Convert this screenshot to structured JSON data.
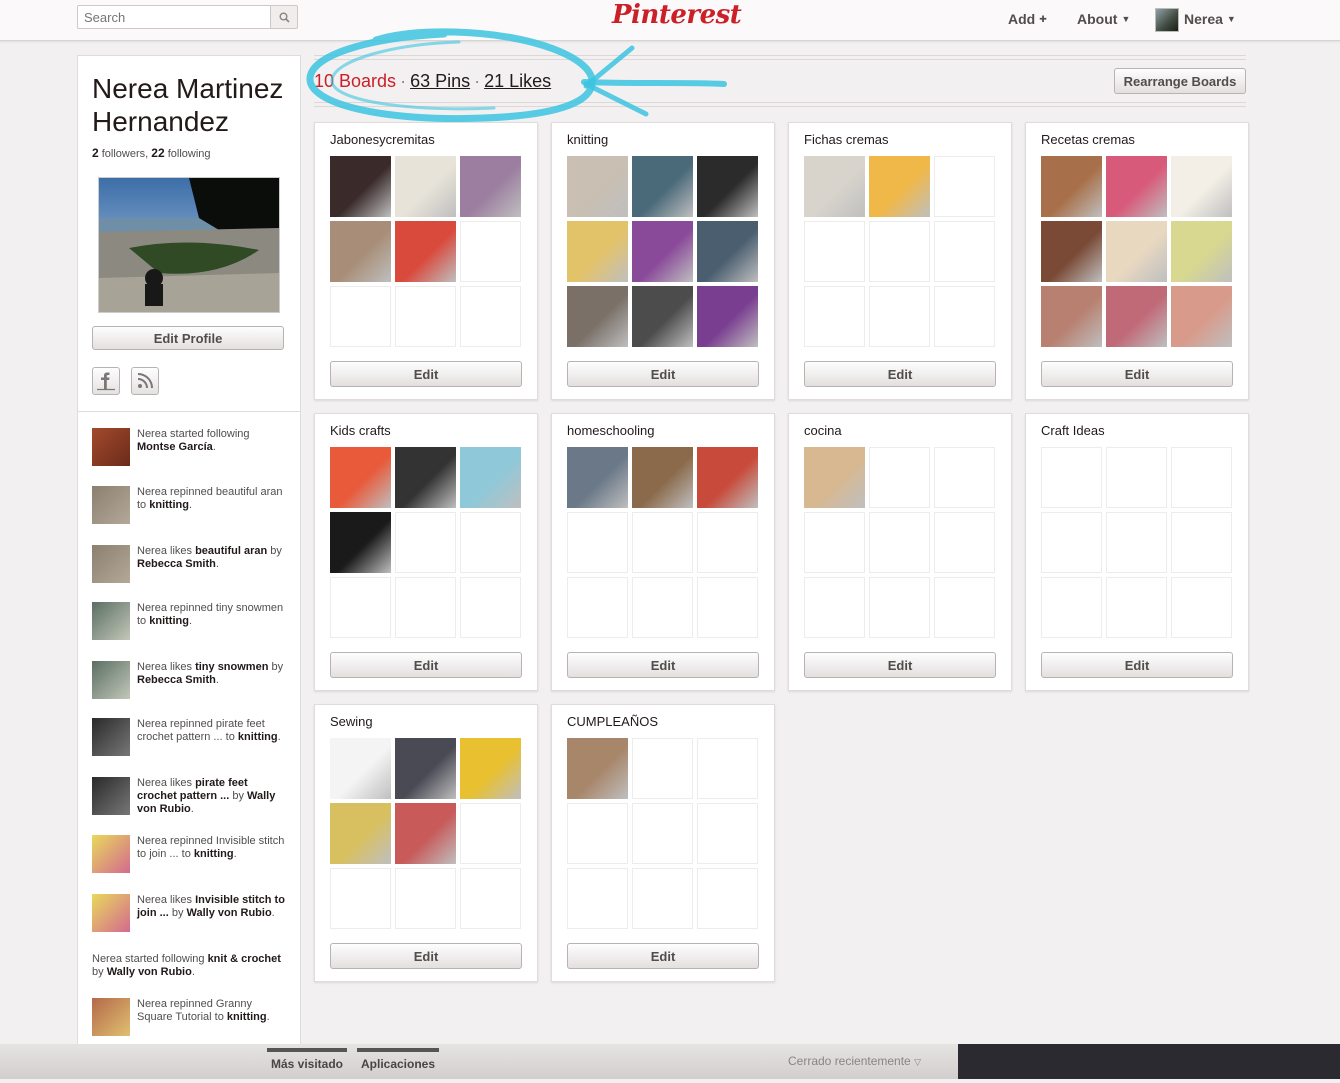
{
  "header": {
    "search_placeholder": "Search",
    "logo": "Pinterest",
    "add_label": "Add",
    "about_label": "About",
    "user_label": "Nerea"
  },
  "profile": {
    "name_line1": "Nerea Martinez",
    "name_line2": "Hernandez",
    "followers_count": "2",
    "followers_label": "followers,",
    "following_count": "22",
    "following_label": "following",
    "edit_profile_label": "Edit Profile"
  },
  "activity": [
    {
      "pre": "Nerea started following ",
      "bold": "Montse García",
      "post": "."
    },
    {
      "pre": "Nerea repinned beautiful aran to ",
      "bold": "knitting",
      "post": "."
    },
    {
      "pre": "Nerea likes ",
      "bold": "beautiful aran",
      "mid": " by ",
      "bold2": "Rebecca Smith",
      "post": "."
    },
    {
      "pre": "Nerea repinned tiny snowmen to ",
      "bold": "knitting",
      "post": "."
    },
    {
      "pre": "Nerea likes ",
      "bold": "tiny snowmen",
      "mid": " by ",
      "bold2": "Rebecca Smith",
      "post": "."
    },
    {
      "pre": "Nerea repinned pirate feet crochet pattern ... to ",
      "bold": "knitting",
      "post": "."
    },
    {
      "pre": "Nerea likes ",
      "bold": "pirate feet crochet pattern ...",
      "mid": " by ",
      "bold2": "Wally von Rubio",
      "post": "."
    },
    {
      "pre": "Nerea repinned Invisible stitch to join ... to ",
      "bold": "knitting",
      "post": "."
    },
    {
      "pre": "Nerea likes ",
      "bold": "Invisible stitch to join ...",
      "mid": " by ",
      "bold2": "Wally von Rubio",
      "post": "."
    },
    {
      "pre": "Nerea started following ",
      "bold": "knit & crochet",
      "mid": " by ",
      "bold2": "Wally von Rubio",
      "post": "."
    },
    {
      "pre": "Nerea repinned Granny Square Tutorial to ",
      "bold": "knitting",
      "post": "."
    }
  ],
  "stats": {
    "boards": "10 Boards",
    "pins": "63 Pins",
    "likes": "21 Likes",
    "separator": "·",
    "rearrange_label": "Rearrange Boards"
  },
  "boards": [
    {
      "title": "Jabonesycremitas",
      "edit": "Edit",
      "pins": 5
    },
    {
      "title": "knitting",
      "edit": "Edit",
      "pins": 9
    },
    {
      "title": "Fichas cremas",
      "edit": "Edit",
      "pins": 2
    },
    {
      "title": "Recetas cremas",
      "edit": "Edit",
      "pins": 9
    },
    {
      "title": "Kids crafts",
      "edit": "Edit",
      "pins": 4
    },
    {
      "title": "homeschooling",
      "edit": "Edit",
      "pins": 3
    },
    {
      "title": "cocina",
      "edit": "Edit",
      "pins": 1
    },
    {
      "title": "Craft Ideas",
      "edit": "Edit",
      "pins": 0
    },
    {
      "title": "Sewing",
      "edit": "Edit",
      "pins": 5
    },
    {
      "title": "CUMPLEAÑOS",
      "edit": "Edit",
      "pins": 1
    }
  ],
  "browser_bar": {
    "most_visited": "Más visitado",
    "apps": "Aplicaciones",
    "recently_closed": "Cerrado recientemente"
  },
  "colors": {
    "brand_red": "#cb2027",
    "annotation_blue": "#3cc4e0"
  }
}
